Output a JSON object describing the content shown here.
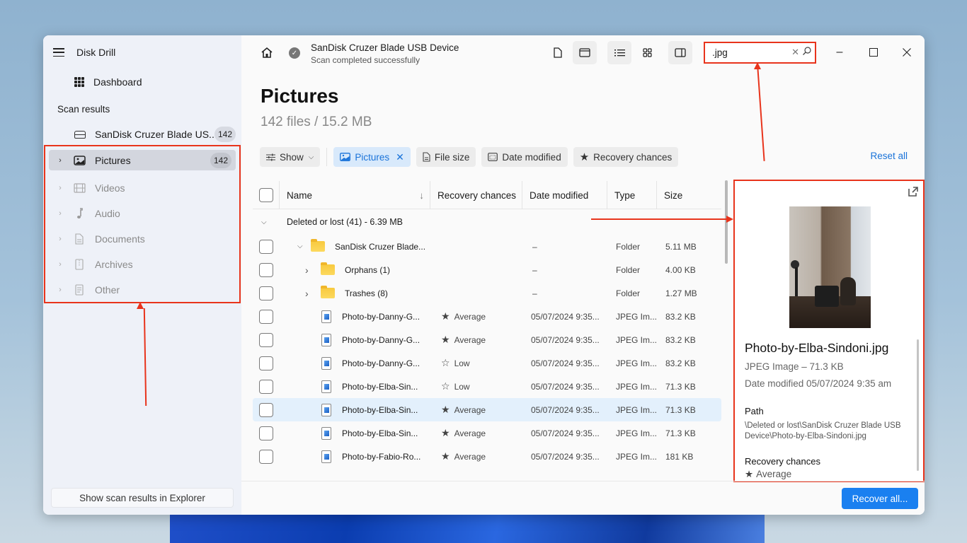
{
  "app": {
    "title": "Disk Drill"
  },
  "sidebar": {
    "dashboard_label": "Dashboard",
    "section_title": "Scan results",
    "device": {
      "label": "SanDisk Cruzer Blade US...",
      "count": "142"
    },
    "categories": [
      {
        "label": "Pictures",
        "count": "142",
        "icon": "image-icon",
        "active": true
      },
      {
        "label": "Videos",
        "icon": "film-icon"
      },
      {
        "label": "Audio",
        "icon": "music-note-icon"
      },
      {
        "label": "Documents",
        "icon": "document-icon"
      },
      {
        "label": "Archives",
        "icon": "archive-icon"
      },
      {
        "label": "Other",
        "icon": "other-file-icon"
      }
    ],
    "show_explorer_label": "Show scan results in Explorer"
  },
  "topbar": {
    "device_title": "SanDisk Cruzer Blade USB Device",
    "device_status": "Scan completed successfully",
    "search": {
      "value": ".jpg",
      "placeholder": "Search"
    }
  },
  "main": {
    "title": "Pictures",
    "subtitle": "142 files / 15.2 MB",
    "filters": {
      "show": "Show",
      "pictures": "Pictures",
      "file_size": "File size",
      "date_modified": "Date modified",
      "recovery_chances": "Recovery chances"
    },
    "reset_all": "Reset all"
  },
  "table": {
    "columns": [
      "Name",
      "Recovery chances",
      "Date modified",
      "Type",
      "Size"
    ],
    "group": {
      "label": "Deleted or lost (41) - 6.39 MB"
    },
    "rows": [
      {
        "name": "SanDisk Cruzer Blade...",
        "kind": "folder",
        "level": 0,
        "expanded": true,
        "recovery": "",
        "date": "–",
        "type": "Folder",
        "size": "5.11 MB"
      },
      {
        "name": "Orphans (1)",
        "kind": "folder",
        "level": 1,
        "expanded": false,
        "recovery": "",
        "date": "–",
        "type": "Folder",
        "size": "4.00 KB"
      },
      {
        "name": "Trashes (8)",
        "kind": "folder",
        "level": 1,
        "expanded": false,
        "recovery": "",
        "date": "–",
        "type": "Folder",
        "size": "1.27 MB"
      },
      {
        "name": "Photo-by-Danny-G...",
        "kind": "file",
        "recovery": "Average",
        "date": "05/07/2024 9:35...",
        "type": "JPEG Im...",
        "size": "83.2 KB"
      },
      {
        "name": "Photo-by-Danny-G...",
        "kind": "file",
        "recovery": "Average",
        "date": "05/07/2024 9:35...",
        "type": "JPEG Im...",
        "size": "83.2 KB"
      },
      {
        "name": "Photo-by-Danny-G...",
        "kind": "file",
        "recovery": "Low",
        "date": "05/07/2024 9:35...",
        "type": "JPEG Im...",
        "size": "83.2 KB"
      },
      {
        "name": "Photo-by-Elba-Sin...",
        "kind": "file",
        "recovery": "Low",
        "date": "05/07/2024 9:35...",
        "type": "JPEG Im...",
        "size": "71.3 KB"
      },
      {
        "name": "Photo-by-Elba-Sin...",
        "kind": "file",
        "recovery": "Average",
        "date": "05/07/2024 9:35...",
        "type": "JPEG Im...",
        "size": "71.3 KB",
        "selected": true
      },
      {
        "name": "Photo-by-Elba-Sin...",
        "kind": "file",
        "recovery": "Average",
        "date": "05/07/2024 9:35...",
        "type": "JPEG Im...",
        "size": "71.3 KB"
      },
      {
        "name": "Photo-by-Fabio-Ro...",
        "kind": "file",
        "recovery": "Average",
        "date": "05/07/2024 9:35...",
        "type": "JPEG Im...",
        "size": "181 KB"
      }
    ]
  },
  "preview": {
    "file_name": "Photo-by-Elba-Sindoni.jpg",
    "type_size": "JPEG Image – 71.3 KB",
    "date_modified": "Date modified 05/07/2024 9:35 am",
    "path_label": "Path",
    "path_value": "\\Deleted or lost\\SanDisk Cruzer Blade USB Device\\Photo-by-Elba-Sindoni.jpg",
    "recovery_label": "Recovery chances",
    "recovery_value": "Average"
  },
  "footer": {
    "recover_all": "Recover all..."
  },
  "colors": {
    "accent": "#1a80f0",
    "annotation": "#e8341c",
    "selected_row": "#e3f0fc"
  }
}
